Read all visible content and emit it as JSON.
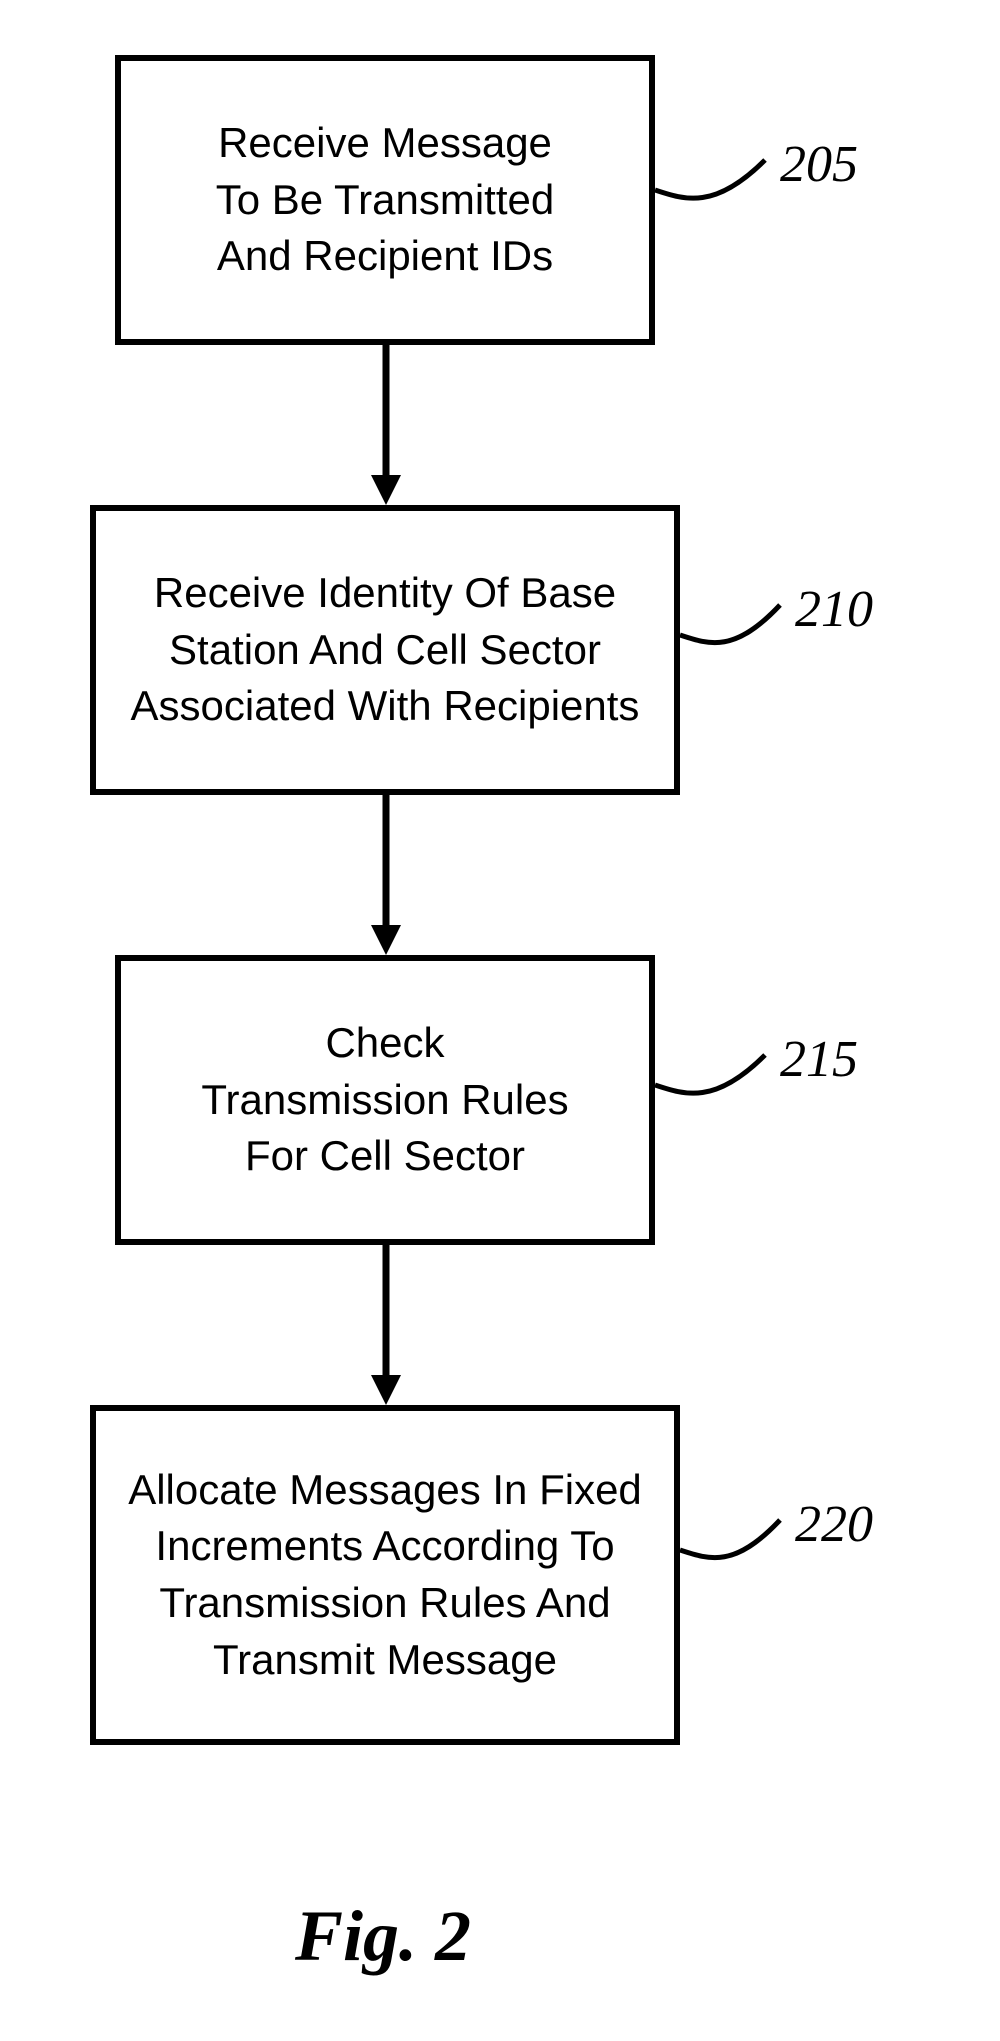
{
  "boxes": {
    "b1": {
      "text": "Receive Message\nTo Be Transmitted\nAnd Recipient IDs",
      "ref": "205"
    },
    "b2": {
      "text": "Receive Identity Of Base\nStation And Cell Sector\nAssociated With Recipients",
      "ref": "210"
    },
    "b3": {
      "text": "Check\nTransmission Rules\nFor Cell Sector",
      "ref": "215"
    },
    "b4": {
      "text": "Allocate Messages In Fixed\nIncrements According To\nTransmission Rules And\nTransmit Message",
      "ref": "220"
    }
  },
  "caption": "Fig. 2"
}
